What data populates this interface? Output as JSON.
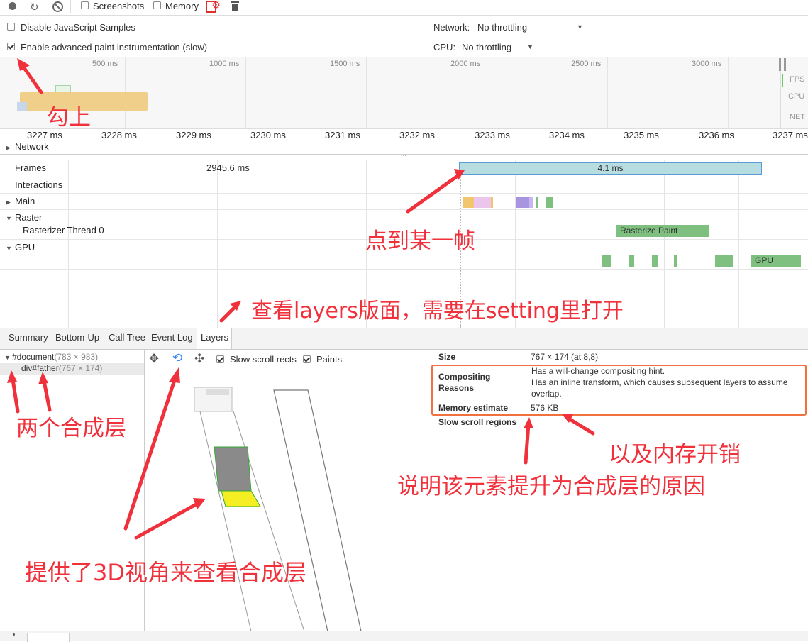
{
  "toolbar": {
    "screenshots_label": "Screenshots",
    "memory_label": "Memory"
  },
  "settings": {
    "disable_js_samples": "Disable JavaScript Samples",
    "enable_paint": "Enable advanced paint instrumentation (slow)",
    "network_label": "Network:",
    "network_value": "No throttling",
    "cpu_label": "CPU:",
    "cpu_value": "No throttling"
  },
  "overview": {
    "ticks": [
      "500 ms",
      "1000 ms",
      "1500 ms",
      "2000 ms",
      "2500 ms",
      "3000 ms"
    ],
    "fps": "FPS",
    "cpu": "CPU",
    "net": "NET"
  },
  "ruler": {
    "ticks": [
      "3227 ms",
      "3228 ms",
      "3229 ms",
      "3230 ms",
      "3231 ms",
      "3232 ms",
      "3233 ms",
      "3234 ms",
      "3235 ms",
      "3236 ms",
      "3237 ms"
    ]
  },
  "tracks": {
    "network": "Network",
    "frames": "Frames",
    "frame_time_1": "2945.6 ms",
    "frame_time_2": "4.1 ms",
    "interactions": "Interactions",
    "main": "Main",
    "raster": "Raster",
    "rasterizer_thread": "Rasterizer Thread 0",
    "rasterize_paint": "Rasterize Paint",
    "gpu": "GPU",
    "gpu_block": "GPU",
    "ellipsis": "..."
  },
  "tabs": [
    "Summary",
    "Bottom-Up",
    "Call Tree",
    "Event Log",
    "Layers"
  ],
  "layers_tree": {
    "document": "#document",
    "document_size": "(783 × 983)",
    "father": "div#father",
    "father_size": "(767 × 174)"
  },
  "layer_toolbar": {
    "slow_scroll_rects": "Slow scroll rects",
    "paints": "Paints"
  },
  "details": {
    "size_label": "Size",
    "size_value": "767 × 174 (at 8,8)",
    "compositing_label_1": "Compositing",
    "compositing_label_2": "Reasons",
    "reason_1": "Has a will-change compositing hint.",
    "reason_2a": "Has an inline transform, which causes subsequent layers to assume",
    "reason_2b": "overlap.",
    "memory_label": "Memory estimate",
    "memory_value": "576 KB",
    "slow_scroll_label": "Slow scroll regions"
  },
  "annotations": {
    "check_on": "勾上",
    "click_frame": "点到某一帧",
    "layers_panel": "查看layers版面，需要在setting里打开",
    "two_layers": "两个合成层",
    "memory_cost": "以及内存开销",
    "reason_explain": "说明该元素提升为合成层的原因",
    "view_3d": "提供了3D视角来查看合成层"
  },
  "colors": {
    "annotation": "#f0303a",
    "frame_selected": "#b8dde0",
    "raster_green": "#7fbf7f"
  }
}
